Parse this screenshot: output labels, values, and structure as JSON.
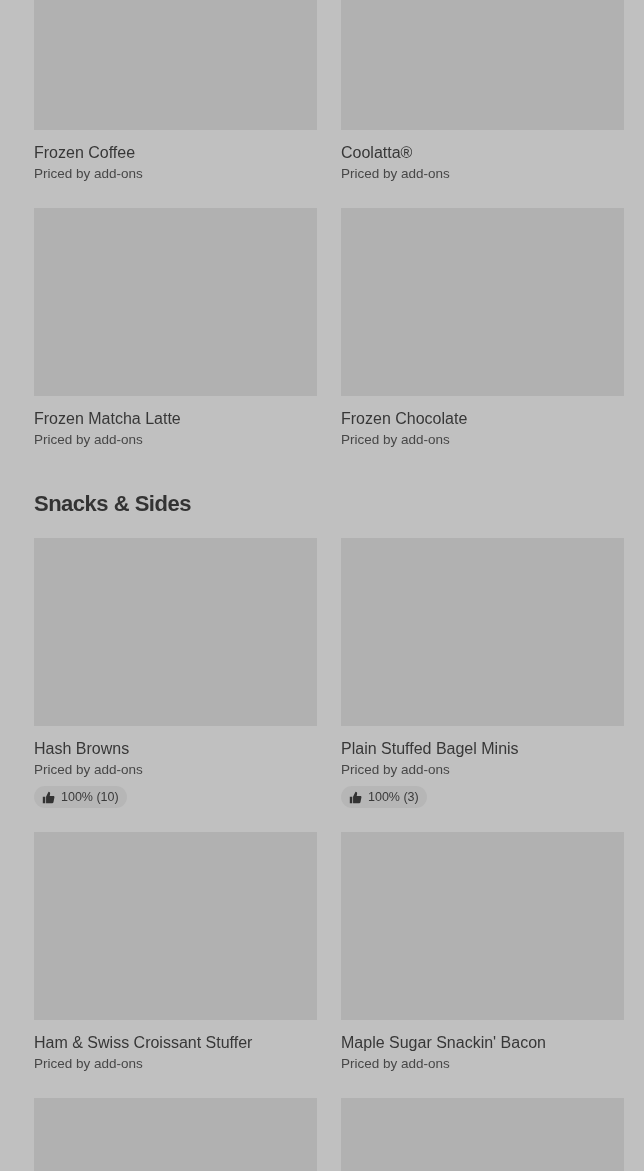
{
  "sections": [
    {
      "items": [
        {
          "kind": "item",
          "name": "Frozen Coffee",
          "subtitle": "Priced by add-ons"
        },
        {
          "kind": "item",
          "name": "Coolatta®",
          "subtitle": "Priced by add-ons"
        },
        {
          "kind": "item",
          "name": "Frozen Matcha Latte",
          "subtitle": "Priced by add-ons"
        },
        {
          "kind": "item",
          "name": "Frozen Chocolate",
          "subtitle": "Priced by add-ons"
        }
      ]
    },
    {
      "title": "Snacks & Sides",
      "items": [
        {
          "kind": "item",
          "name": "Hash Browns",
          "subtitle": "Priced by add-ons",
          "rating": "100% (10)"
        },
        {
          "kind": "item",
          "name": "Plain Stuffed Bagel Minis",
          "subtitle": "Priced by add-ons",
          "rating": "100% (3)"
        },
        {
          "kind": "item",
          "name": "Ham & Swiss Croissant Stuffer",
          "subtitle": "Priced by add-ons"
        },
        {
          "kind": "item",
          "name": "Maple Sugar Snackin' Bacon",
          "subtitle": "Priced by add-ons"
        },
        {
          "kind": "image-only"
        },
        {
          "kind": "image-only"
        }
      ]
    }
  ]
}
